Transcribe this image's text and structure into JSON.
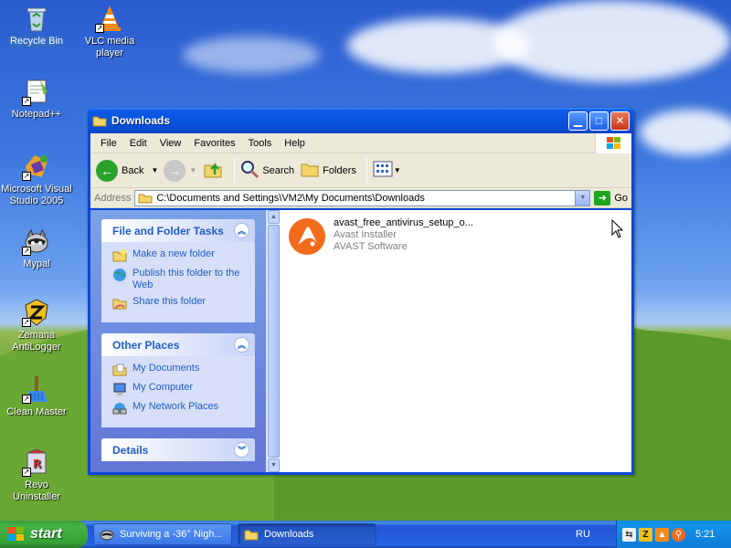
{
  "desktop": {
    "icons": [
      {
        "label": "Recycle Bin",
        "icon": "recycle-bin-icon"
      },
      {
        "label": "VLC media player",
        "icon": "vlc-cone-icon"
      },
      {
        "label": "Notepad++",
        "icon": "notepad-plus-plus-icon"
      },
      {
        "label": "Microsoft Visual Studio 2005",
        "icon": "visual-studio-icon"
      },
      {
        "label": "Mypal",
        "icon": "mypal-raccoon-icon"
      },
      {
        "label": "Zemana AntiLogger",
        "icon": "zemana-icon"
      },
      {
        "label": "Clean Master",
        "icon": "broom-icon"
      },
      {
        "label": "Revo Uninstaller",
        "icon": "revo-uninstaller-icon"
      }
    ]
  },
  "window": {
    "title": "Downloads",
    "menu": [
      "File",
      "Edit",
      "View",
      "Favorites",
      "Tools",
      "Help"
    ],
    "toolbar": {
      "back_label": "Back",
      "search_label": "Search",
      "folders_label": "Folders"
    },
    "address": {
      "label": "Address",
      "path": "C:\\Documents and Settings\\VM2\\My Documents\\Downloads",
      "go_label": "Go"
    },
    "task_pane": {
      "file_tasks": {
        "title": "File and Folder Tasks",
        "items": [
          "Make a new folder",
          "Publish this folder to the Web",
          "Share this folder"
        ]
      },
      "other_places": {
        "title": "Other Places",
        "items": [
          "My Documents",
          "My Computer",
          "My Network Places"
        ]
      },
      "details": {
        "title": "Details"
      }
    },
    "files": [
      {
        "name": "avast_free_antivirus_setup_o...",
        "description": "Avast Installer",
        "company": "AVAST Software",
        "icon": "avast-icon"
      }
    ]
  },
  "taskbar": {
    "start_label": "start",
    "buttons": [
      {
        "label": "Surviving a -36° Nigh...",
        "active": false
      },
      {
        "label": "Downloads",
        "active": true
      }
    ],
    "language": "RU",
    "clock": "5:21"
  },
  "colors": {
    "xp_blue": "#0a48d8",
    "task_link": "#215dc6",
    "start_green": "#3c9a3c",
    "avast_orange": "#f26b1d"
  }
}
